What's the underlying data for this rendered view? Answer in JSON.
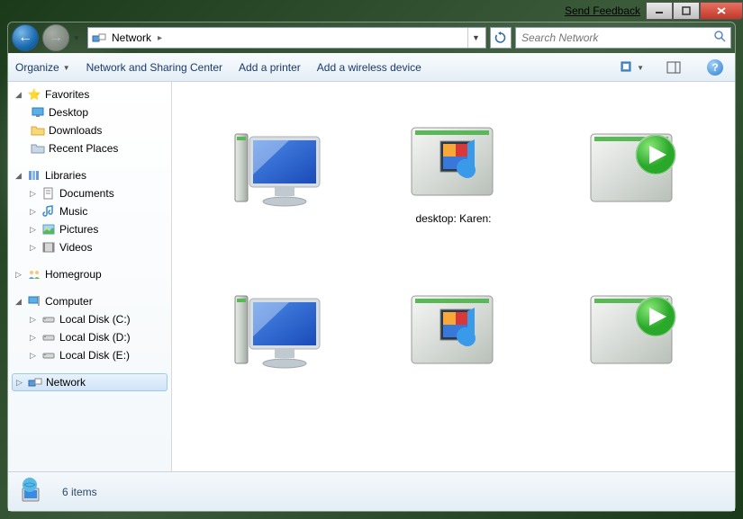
{
  "titlebar": {
    "feedback": "Send Feedback"
  },
  "nav": {
    "address_label": "Network",
    "search_placeholder": "Search Network"
  },
  "toolbar": {
    "organize": "Organize",
    "nsc": "Network and Sharing Center",
    "add_printer": "Add a printer",
    "add_wireless": "Add a wireless device"
  },
  "sidebar": {
    "favorites": {
      "label": "Favorites",
      "items": [
        "Desktop",
        "Downloads",
        "Recent Places"
      ]
    },
    "libraries": {
      "label": "Libraries",
      "items": [
        "Documents",
        "Music",
        "Pictures",
        "Videos"
      ]
    },
    "homegroup": {
      "label": "Homegroup"
    },
    "computer": {
      "label": "Computer",
      "items": [
        "Local Disk (C:)",
        "Local Disk (D:)",
        "Local Disk (E:)"
      ]
    },
    "network": {
      "label": "Network"
    }
  },
  "items": [
    {
      "type": "computer",
      "label": ""
    },
    {
      "type": "media",
      "label": "desktop: Karen:"
    },
    {
      "type": "player",
      "label": ""
    },
    {
      "type": "computer",
      "label": ""
    },
    {
      "type": "media",
      "label": ""
    },
    {
      "type": "player",
      "label": ""
    }
  ],
  "status": {
    "count": "6 items"
  }
}
